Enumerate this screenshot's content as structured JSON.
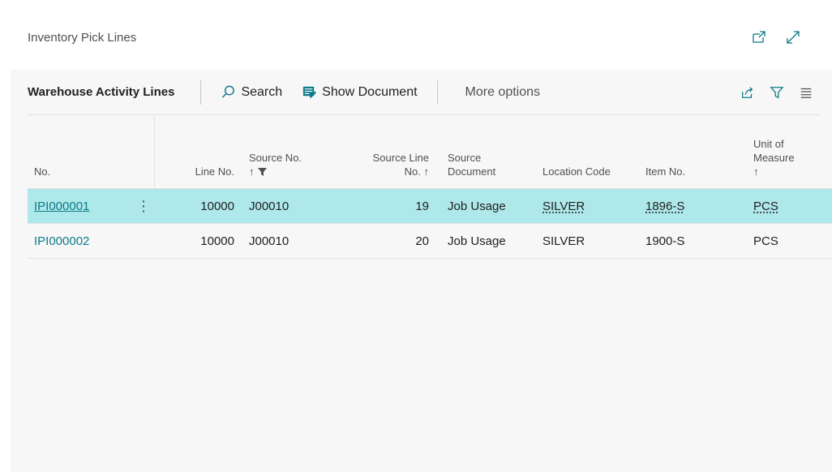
{
  "page": {
    "title": "Inventory Pick Lines"
  },
  "actionbar": {
    "title": "Warehouse Activity Lines",
    "search_label": "Search",
    "show_document_label": "Show Document",
    "more_options_label": "More options"
  },
  "table": {
    "columns": {
      "no": "No.",
      "line_no": "Line No.",
      "source_no_1": "Source No.",
      "source_no_2": "↑",
      "source_line_no_1": "Source Line",
      "source_line_no_2": "No. ↑",
      "source_doc_1": "Source",
      "source_doc_2": "Document",
      "location_code": "Location Code",
      "item_no": "Item No.",
      "uom_1": "Unit of",
      "uom_2": "Measure",
      "uom_3": "↑"
    },
    "rows": [
      {
        "no": "IPI000001",
        "line_no": "10000",
        "source_no": "J00010",
        "source_line_no": "19",
        "source_document": "Job Usage",
        "location_code": "SILVER",
        "item_no": "1896-S",
        "uom": "PCS"
      },
      {
        "no": "IPI000002",
        "line_no": "10000",
        "source_no": "J00010",
        "source_line_no": "20",
        "source_document": "Job Usage",
        "location_code": "SILVER",
        "item_no": "1900-S",
        "uom": "PCS"
      }
    ]
  },
  "colors": {
    "accent": "#0c7a89",
    "selected_row": "#aee8ea",
    "panel_bg": "#f7f7f7"
  }
}
